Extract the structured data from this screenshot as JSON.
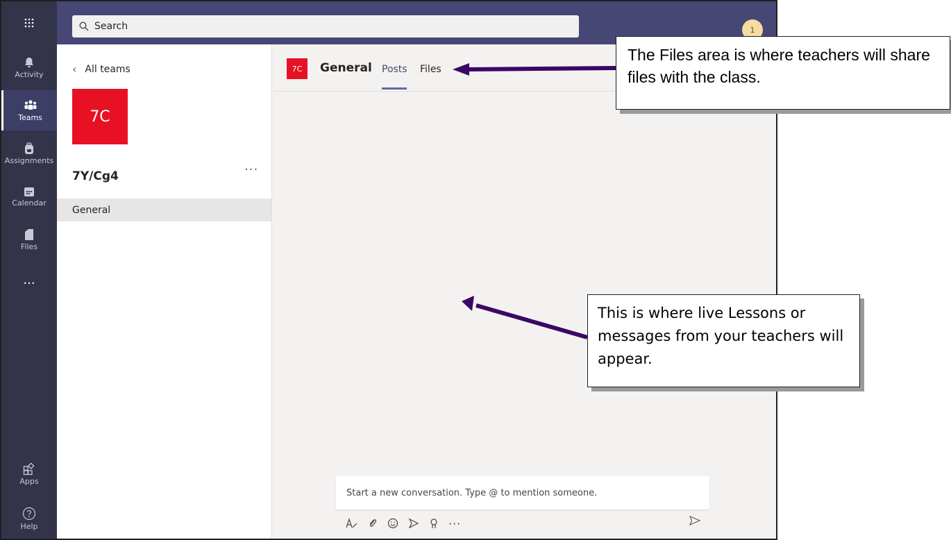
{
  "topbar": {
    "waffle_icon": "app-launcher-icon",
    "search_placeholder": "Search",
    "avatar_badge": "1"
  },
  "rail": {
    "items": [
      {
        "label": "Activity",
        "icon": "bell-icon"
      },
      {
        "label": "Teams",
        "icon": "teams-icon"
      },
      {
        "label": "Assignments",
        "icon": "backpack-icon"
      },
      {
        "label": "Calendar",
        "icon": "calendar-icon"
      },
      {
        "label": "Files",
        "icon": "file-icon"
      },
      {
        "label": "...",
        "icon": "more-icon"
      },
      {
        "label": "Apps",
        "icon": "apps-icon"
      },
      {
        "label": "Help",
        "icon": "help-icon"
      }
    ],
    "active": "Teams"
  },
  "teams_panel": {
    "back_label": "All teams",
    "team_tile": "7C",
    "team_name": "7Y/Cg4",
    "more_label": "···",
    "channels": [
      "General"
    ]
  },
  "channel_header": {
    "tile": "7C",
    "name": "General",
    "tabs": [
      "Posts",
      "Files"
    ],
    "active_tab": "Posts"
  },
  "compose": {
    "placeholder": "Start a new conversation. Type @ to mention someone.",
    "toolbar_icons": [
      "format-icon",
      "attach-icon",
      "emoji-icon",
      "gif-icon",
      "praise-icon",
      "more-icon"
    ],
    "send_icon": "send-icon"
  },
  "annotations": {
    "files_callout": "The Files area is where teachers will share files with the class.",
    "lessons_callout": "This is where live Lessons or messages from your teachers will appear.",
    "arrow_color": "#3b0764"
  },
  "colors": {
    "topbar": "#464775",
    "rail": "#33344a",
    "team_tile": "#e81123",
    "accent": "#6264a7"
  }
}
